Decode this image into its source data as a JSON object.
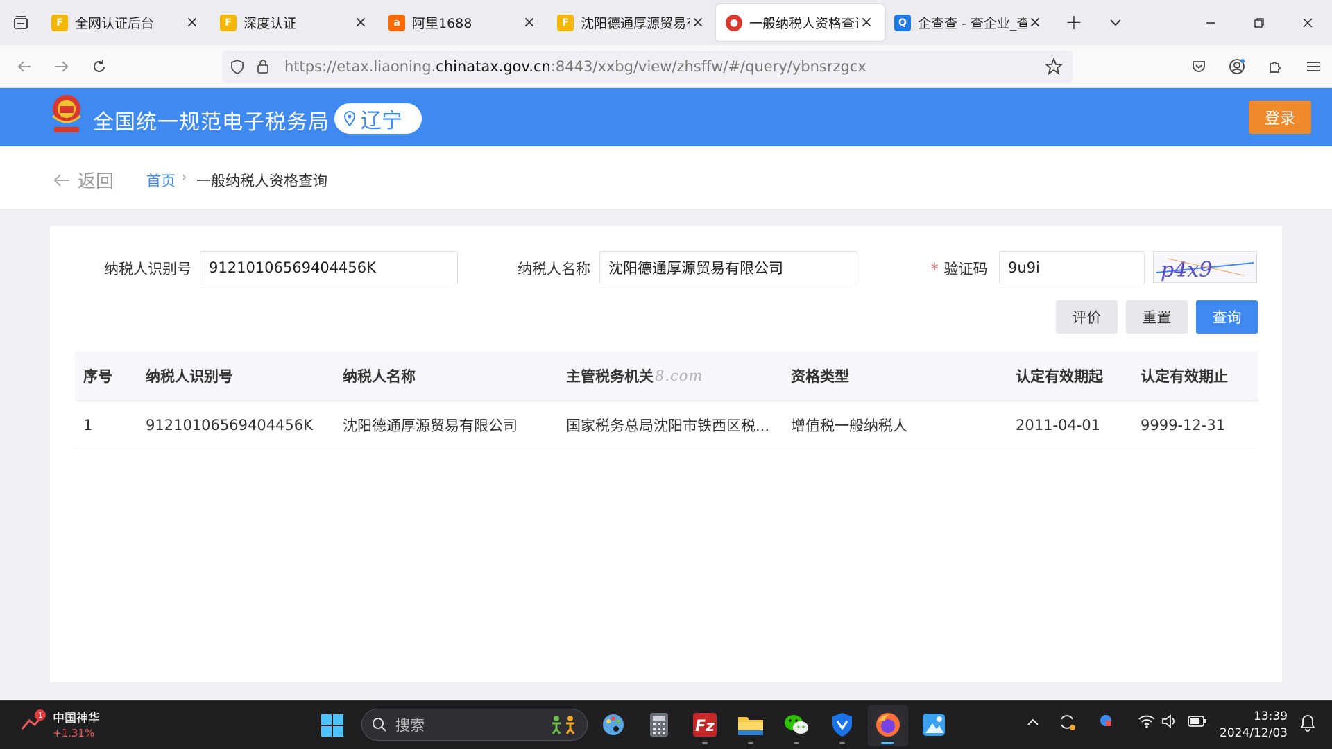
{
  "browser": {
    "tabs": [
      {
        "title": "全网认证后台",
        "favicon": "flag-icon",
        "active": false
      },
      {
        "title": "深度认证",
        "favicon": "flag-icon",
        "active": false
      },
      {
        "title": "阿里1688",
        "favicon": "alibaba-icon",
        "active": false
      },
      {
        "title": "沈阳德通厚源贸易有",
        "favicon": "flag-icon",
        "active": false
      },
      {
        "title": "一般纳税人资格查询",
        "favicon": "tax-emblem-icon",
        "active": true
      },
      {
        "title": "企查查 - 查企业_查",
        "favicon": "qichacha-icon",
        "active": false
      }
    ],
    "url_prefix": "https://etax.liaoning.",
    "url_domain": "chinatax.gov.cn",
    "url_suffix": ":8443/xxbg/view/zhsffw/#/query/ybnsrzgcx"
  },
  "site": {
    "title": "全国统一规范电子税务局",
    "region": "辽宁",
    "login_label": "登录",
    "brand_color": "#3e8af0",
    "login_color": "#f08a2c"
  },
  "breadcrumb": {
    "back_label": "返回",
    "home_label": "首页",
    "separator": "›",
    "current": "一般纳税人资格查询"
  },
  "form": {
    "taxpayer_id_label": "纳税人识别号",
    "taxpayer_id_value": "91210106569404456K",
    "taxpayer_name_label": "纳税人名称",
    "taxpayer_name_value": "沈阳德通厚源贸易有限公司",
    "captcha_required_mark": "*",
    "captcha_label": "验证码",
    "captcha_value": "9u9i",
    "captcha_image_text": "p4x9",
    "evaluate_label": "评价",
    "reset_label": "重置",
    "query_label": "查询"
  },
  "table": {
    "headers": [
      "序号",
      "纳税人识别号",
      "纳税人名称",
      "主管税务机关",
      "资格类型",
      "认定有效期起",
      "认定有效期止"
    ],
    "header_watermark": "8.com",
    "rows": [
      [
        "1",
        "91210106569404456K",
        "沈阳德通厚源贸易有限公司",
        "国家税务总局沈阳市铁西区税...",
        "增值税一般纳税人",
        "2011-04-01",
        "9999-12-31"
      ]
    ]
  },
  "taskbar": {
    "stock_name": "中国神华",
    "stock_change": "+1.31%",
    "stock_badge": "1",
    "search_placeholder": "搜索",
    "time": "13:39",
    "date": "2024/12/03"
  }
}
